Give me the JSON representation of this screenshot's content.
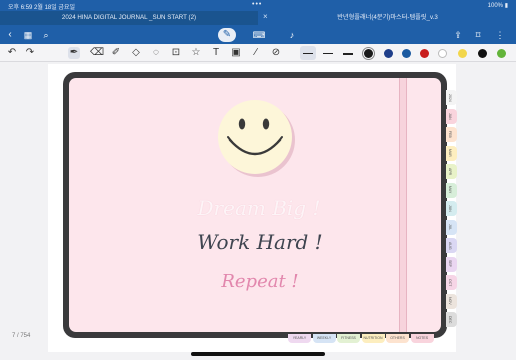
{
  "status": {
    "time_date": "오후 6:59   2월 18일 금요일",
    "battery": "100%"
  },
  "tabs": [
    {
      "label": "2024 HINA DIGITAL JOURNAL _SUN START (2)"
    },
    {
      "label": "반년형플래너(4분기)마스터-템플릿_v.3"
    }
  ],
  "toolbar": {
    "back_icon": "chevron-left-icon",
    "grid_icon": "grid-icon",
    "search_icon": "search-icon",
    "pen_mode_icon": "pen-circle-icon",
    "keyboard_icon": "keyboard-icon",
    "mic_icon": "mic-icon",
    "share_icon": "share-icon",
    "bookmark_icon": "bookmark-icon",
    "more_icon": "more-icon"
  },
  "tools": {
    "undo_icon": "undo-icon",
    "redo_icon": "redo-icon",
    "colors": [
      "#1a1a1a",
      "#1f3f8a",
      "#1b5aa0",
      "#c91e1e",
      "#ffffff",
      "#f2d64b",
      "#111111",
      "#63b43a"
    ]
  },
  "journal": {
    "line1": "Dream Big !",
    "line2": "Work Hard !",
    "line3": "Repeat !",
    "month_tabs": [
      "2024",
      "JAN",
      "FEB",
      "MAR",
      "APR",
      "MAY",
      "JUN",
      "JUL",
      "AUG",
      "SEP",
      "OCT",
      "NOV",
      "DEC"
    ],
    "month_colors": [
      "#f4f4f4",
      "#f9d4dd",
      "#fde3cf",
      "#fdeebf",
      "#e8f2c8",
      "#d7eed9",
      "#d4ecef",
      "#d6e4f5",
      "#dad7f3",
      "#ead6f1",
      "#f6d5e6",
      "#ece4dd",
      "#dcdcdc"
    ],
    "bottom_tabs": [
      "YEARLY",
      "WEEKLY",
      "FITNESS",
      "NUTRITION",
      "OTHERS",
      "NOTES"
    ],
    "bottom_colors": [
      "#efd9f0",
      "#d6e4f5",
      "#e3f1d3",
      "#fdeebf",
      "#fde3cf",
      "#f9d4dd"
    ]
  },
  "page_indicator": "7 / 754"
}
